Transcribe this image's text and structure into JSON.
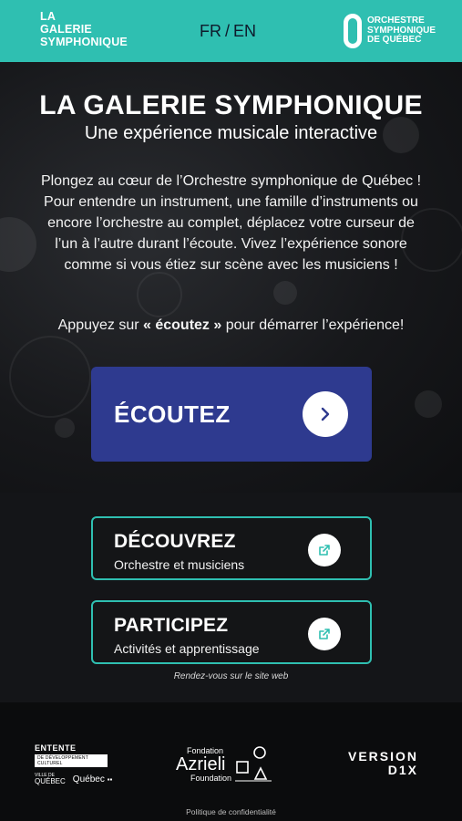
{
  "header": {
    "brand_lines": [
      "LA",
      "GALERIE",
      "SYMPHONIQUE"
    ],
    "lang_fr": "FR",
    "lang_sep": "/",
    "lang_en": "EN",
    "osq_lines": [
      "ORCHESTRE",
      "SYMPHONIQUE",
      "DE QUÉBEC"
    ],
    "bg_color": "#2fbfb1"
  },
  "hero": {
    "title": "LA GALERIE SYMPHONIQUE",
    "subtitle": "Une expérience musicale interactive",
    "description": "Plongez au cœur de l’Orchestre symphonique de Québec ! Pour entendre un instrument, une famille d’instruments ou encore l’orchestre au complet, déplacez votre curseur de l’un à l’autre durant l’écoute. Vivez l’expérience sonore comme si vous étiez sur scène avec les musiciens !",
    "cta_prefix": "Appuyez sur ",
    "cta_bold": "« écoutez »",
    "cta_suffix": " pour démarrer l’expérience!",
    "listen_label": "ÉCOUTEZ",
    "listen_icon": "chevron-right-icon",
    "button_color": "#2e3a8f"
  },
  "cards": [
    {
      "title": "DÉCOUVREZ",
      "subtitle": "Orchestre et musiciens",
      "icon": "external-link-icon"
    },
    {
      "title": "PARTICIPEZ",
      "subtitle": "Activités et apprentissage",
      "icon": "external-link-icon"
    }
  ],
  "website_note": "Rendez-vous sur le site web",
  "footer": {
    "entente_title": "ENTENTE",
    "entente_band": "DE DÉVELOPPEMENT CULTUREL",
    "ville_lines": [
      "VILLE DE",
      "QUÉBEC"
    ],
    "quebec": "Québec",
    "azrieli_top": "Fondation",
    "azrieli_name": "Azrieli",
    "azrieli_bottom": "Foundation",
    "version_line1": "VERSION",
    "version_line2": "D1X",
    "privacy": "Politique de confidentialité"
  },
  "accent_color": "#2fbfb1"
}
